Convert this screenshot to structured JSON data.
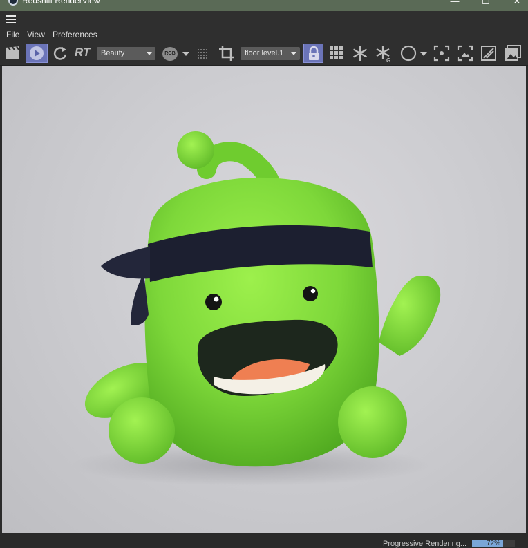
{
  "window": {
    "title": "Redshift RenderView",
    "min_glyph": "—",
    "max_glyph": "☐",
    "close_glyph": "✕"
  },
  "menu": [
    "File",
    "View",
    "Preferences"
  ],
  "toolbar": {
    "rt_label": "RT",
    "aov_select": "Beauty",
    "rgb_label": "RGB",
    "camera_select": "floor level.1",
    "icons": [
      "clapboard-icon",
      "play-icon",
      "refresh-icon",
      "grid-dots-icon",
      "crop-icon",
      "lock-icon",
      "grid-icon",
      "snowflake-icon",
      "snowflake-g-icon",
      "circle-icon",
      "focus-icon",
      "region-icon",
      "edit-icon",
      "image-icon"
    ]
  },
  "status": {
    "text": "Progressive Rendering...",
    "progress_percent": 72,
    "progress_label": "72%"
  },
  "colors": {
    "accent": "#6b74b8",
    "character": "#7ed83a",
    "headband": "#1c1f30"
  }
}
